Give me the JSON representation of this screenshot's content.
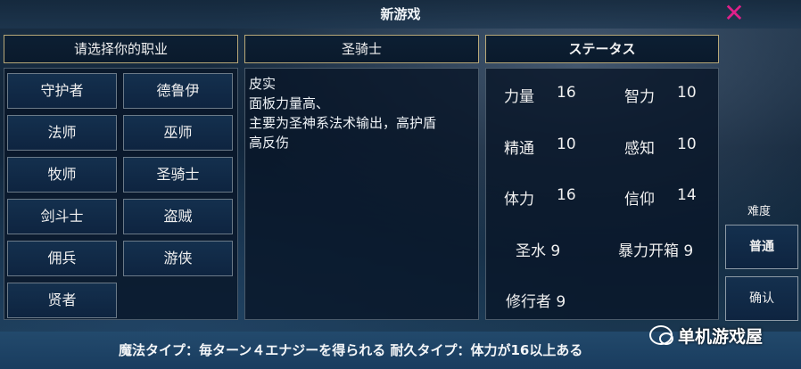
{
  "window": {
    "title": "新游戏"
  },
  "class_panel": {
    "header": "请选择你的职业",
    "classes": [
      "守护者",
      "德鲁伊",
      "法师",
      "巫师",
      "牧师",
      "圣骑士",
      "剑斗士",
      "盗贼",
      "佣兵",
      "游侠",
      "贤者"
    ]
  },
  "detail_panel": {
    "header": "圣骑士",
    "description": [
      "皮实",
      "面板力量高、",
      "主要为圣神系法术输出，高护盾",
      "高反伤"
    ]
  },
  "status_panel": {
    "header": "ステータス",
    "stats": [
      {
        "label": "力量",
        "value": "16"
      },
      {
        "label": "智力",
        "value": "10"
      },
      {
        "label": "精通",
        "value": "10"
      },
      {
        "label": "感知",
        "value": "10"
      },
      {
        "label": "体力",
        "value": "16"
      },
      {
        "label": "信仰",
        "value": "14"
      },
      {
        "label": "圣水 9"
      },
      {
        "label": "暴力开箱 9"
      },
      {
        "label": "修行者 9"
      }
    ]
  },
  "difficulty": {
    "label": "难度",
    "value": "普通",
    "confirm": "确认"
  },
  "bottom": {
    "text": "魔法タイプ：毎ターン４エナジーを得られる  耐久タイプ：体力が16以上ある"
  },
  "watermark": {
    "text": "单机游戏屋",
    "icon": "wechat-icon"
  },
  "colors": {
    "accent_close": "#e0208a",
    "header_border": "#b8a878"
  }
}
